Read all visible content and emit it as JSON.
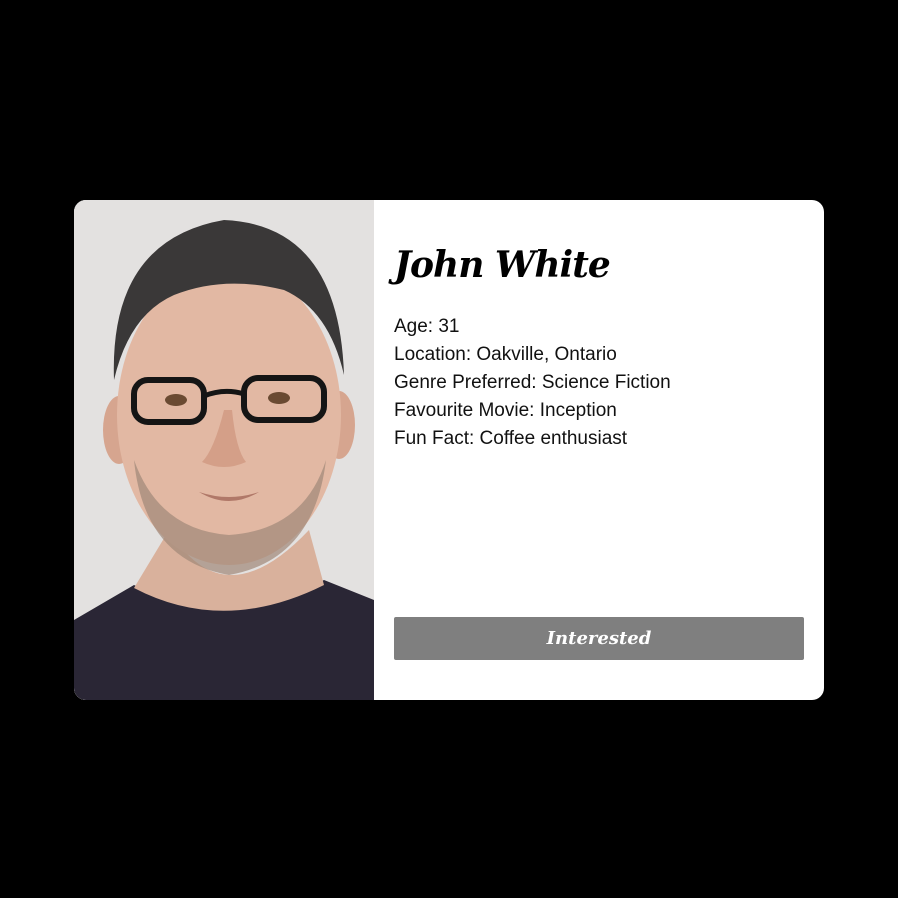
{
  "profile": {
    "name": "John White",
    "details": [
      "Age: 31",
      "Location: Oakville, Ontario",
      "Genre Preferred: Science Fiction",
      "Favourite Movie: Inception",
      "Fun Fact: Coffee enthusiast"
    ],
    "button_label": "Interested"
  },
  "colors": {
    "page_background": "#000000",
    "card_background": "#ffffff",
    "button_background": "#7f7f7f",
    "button_text": "#ffffff"
  }
}
